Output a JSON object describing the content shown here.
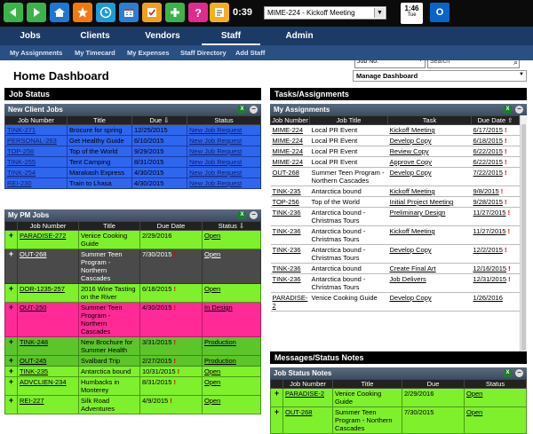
{
  "toolbar": {
    "clock": "0:39",
    "meeting": "MIME-224 - Kickoff Meeting",
    "date_time": "1:46",
    "date_day": "Tue",
    "icons": [
      "back-icon",
      "forward-icon",
      "home-icon",
      "star-icon",
      "clock-icon",
      "calendar-icon",
      "checklist-icon",
      "add-icon",
      "help-icon",
      "notes-icon",
      "outlook-icon"
    ]
  },
  "nav": {
    "tabs": [
      "Jobs",
      "Clients",
      "Vendors",
      "Staff",
      "Admin"
    ],
    "active": "Staff",
    "job_select": "Job No.",
    "search_placeholder": "Search"
  },
  "subnav": [
    "My Assignments",
    "My Timecard",
    "My Expenses",
    "Staff Directory",
    "Add Staff"
  ],
  "page_title": "Home Dashboard",
  "manage_dashboard": "Manage Dashboard",
  "job_status": {
    "title": "Job Status",
    "new_client_jobs": {
      "title": "New Client Jobs",
      "columns": [
        "Job Number",
        "Title",
        "Due ⇩",
        "Status"
      ],
      "rows": [
        [
          "TINK-271",
          "Brocure for spring",
          "12/25/2015",
          "New Job Request"
        ],
        [
          "PERSONAL-263",
          "Get Healthy Guide",
          "6/10/2015",
          "New Job Request"
        ],
        [
          "TOP-256",
          "Top of the World",
          "9/29/2015",
          "New Job Request"
        ],
        [
          "TINK-255",
          "Tent Camping",
          "8/31/2015",
          "New Job Request"
        ],
        [
          "TINK-254",
          "Marakash Express",
          "4/30/2015",
          "New Job Request"
        ],
        [
          "REI-230",
          "Train to Lhasa",
          "4/30/2015",
          "New Job Request"
        ]
      ]
    },
    "my_pm_jobs": {
      "title": "My PM Jobs",
      "columns": [
        "",
        "Job Number",
        "Title",
        "Due Date",
        "Status ⇩"
      ],
      "rows": [
        {
          "job": "PARADISE-272",
          "title": "Venice Cooking Guide",
          "due": "2/29/2016",
          "late": false,
          "status": "Open",
          "style": "green"
        },
        {
          "job": "OUT-268",
          "title": "Summer Teen Program - Northern Cascades",
          "due": "7/30/2015",
          "late": true,
          "status": "Open",
          "style": "gray"
        },
        {
          "job": "DOR-1235-257",
          "title": "2016 Wine Tasting on the River",
          "due": "6/18/2015",
          "late": true,
          "status": "Open",
          "style": "green"
        },
        {
          "job": "OUT-250",
          "title": "Summer Teen Program - Northern Cascades",
          "due": "4/30/2015",
          "late": true,
          "status": "In Design",
          "style": "pink"
        },
        {
          "job": "TINK-248",
          "title": "New Brochure for Summer Health",
          "due": "3/31/2015",
          "late": true,
          "status": "Production",
          "style": "darkgreen"
        },
        {
          "job": "OUT-245",
          "title": "Svalbard Trip",
          "due": "2/27/2015",
          "late": true,
          "status": "Production",
          "style": "darkgreen"
        },
        {
          "job": "TINK-235",
          "title": "Antarctica bound",
          "due": "10/31/2015",
          "late": true,
          "status": "Open",
          "style": "green"
        },
        {
          "job": "ADVCLIEN-234",
          "title": "Humbacks in Monterey",
          "due": "8/31/2015",
          "late": true,
          "status": "Open",
          "style": "green"
        },
        {
          "job": "REI-227",
          "title": "Silk Road Adventures",
          "due": "4/9/2015",
          "late": true,
          "status": "Open",
          "style": "green"
        }
      ]
    }
  },
  "tasks": {
    "title": "Tasks/Assignments",
    "my_assignments": {
      "title": "My Assignments",
      "columns": [
        "Job Number",
        "Job Title",
        "Task",
        "Due Date ⇧"
      ],
      "rows": [
        {
          "job": "MIME-224",
          "title": "Local PR Event",
          "task": "Kickoff Meeting",
          "due": "6/17/2015",
          "late": true
        },
        {
          "job": "MIME-224",
          "title": "Local PR Event",
          "task": "Develop Copy",
          "due": "6/18/2015",
          "late": true
        },
        {
          "job": "MIME-224",
          "title": "Local PR Event",
          "task": "Review Copy",
          "due": "6/22/2015",
          "late": true
        },
        {
          "job": "MIME-224",
          "title": "Local PR Event",
          "task": "Approve Copy",
          "due": "6/22/2015",
          "late": true
        },
        {
          "job": "OUT-268",
          "title": "Summer Teen Program - Northern Cascades",
          "task": "Develop Copy",
          "due": "7/22/2015",
          "late": true
        },
        {
          "job": "TINK-235",
          "title": "Antarctica bound",
          "task": "Kickoff Meeting",
          "due": "9/8/2015",
          "late": true
        },
        {
          "job": "TOP-256",
          "title": "Top of the World",
          "task": "Initial Project Meeting",
          "due": "9/28/2015",
          "late": true
        },
        {
          "job": "TINK-236",
          "title": "Antarctica bound - Christmas Tours",
          "task": "Preliminary Design",
          "due": "11/27/2015",
          "late": true
        },
        {
          "job": "TINK-236",
          "title": "Antarctica bound - Christmas Tours",
          "task": "Kickoff Meeting",
          "due": "11/27/2015",
          "late": true
        },
        {
          "job": "TINK-236",
          "title": "Antarctica bound - Christmas Tours",
          "task": "Develop Copy",
          "due": "12/2/2015",
          "late": true
        },
        {
          "job": "TINK-236",
          "title": "Antarctica bound",
          "task": "Create Final Art",
          "due": "12/16/2015",
          "late": true
        },
        {
          "job": "TINK-236",
          "title": "Antarctica bound - Christmas Tours",
          "task": "Job Delivers",
          "due": "12/31/2015",
          "late": true
        },
        {
          "job": "PARADISE-2",
          "title": "Venice Cooking Guide",
          "task": "Develop Copy",
          "due": "1/26/2016",
          "late": false
        }
      ]
    }
  },
  "messages": {
    "title": "Messages/Status Notes",
    "job_status_notes": {
      "title": "Job Status Notes",
      "columns": [
        "",
        "Job Number",
        "Title",
        "Due",
        "Status"
      ],
      "rows": [
        {
          "job": "PARADISE-2",
          "title": "Venice Cooking Guide",
          "due": "2/29/2016",
          "status": "Open"
        },
        {
          "job": "OUT-268",
          "title": "Summer Teen Program - Northern Cascades",
          "due": "7/30/2015",
          "status": "Open"
        }
      ]
    }
  }
}
